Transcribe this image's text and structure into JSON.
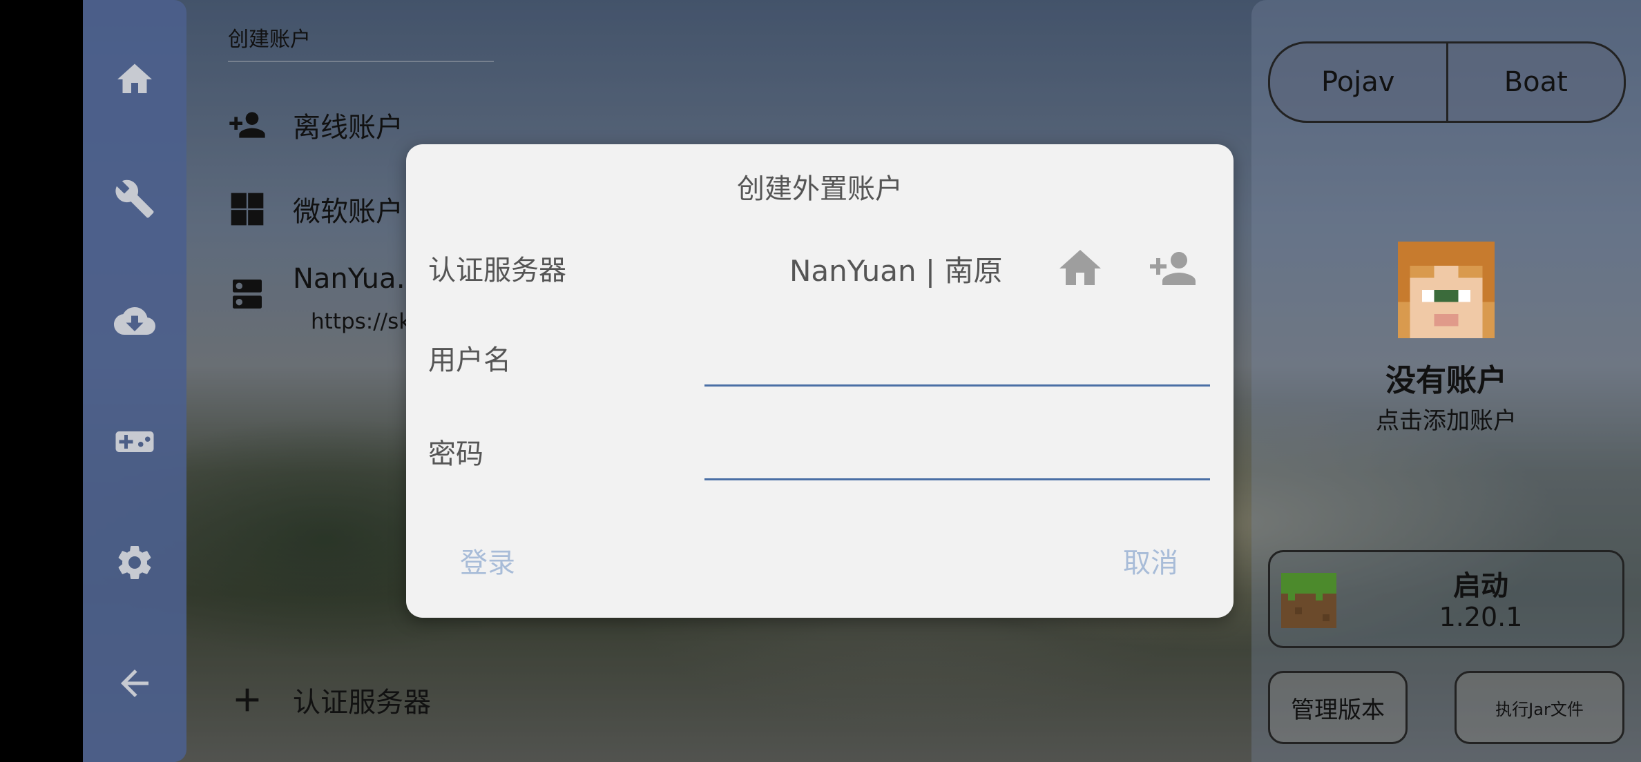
{
  "left_rail": {
    "items": [
      {
        "name": "home-icon"
      },
      {
        "name": "wrench-icon"
      },
      {
        "name": "cloud-download-icon"
      },
      {
        "name": "gamepad-icon"
      },
      {
        "name": "gear-icon"
      },
      {
        "name": "back-arrow-icon"
      }
    ]
  },
  "accounts": {
    "title": "创建账户",
    "offline_label": "离线账户",
    "microsoft_label": "微软账户",
    "server_item": {
      "name": "NanYua…",
      "url": "https://skin"
    },
    "add_server_label": "认证服务器"
  },
  "dialog": {
    "title": "创建外置账户",
    "server_label": "认证服务器",
    "server_value": "NanYuan | 南原",
    "username_label": "用户名",
    "username_value": "",
    "password_label": "密码",
    "password_value": "",
    "login_label": "登录",
    "cancel_label": "取消"
  },
  "right_panel": {
    "launcher_tabs": [
      "Pojav",
      "Boat"
    ],
    "no_account": "没有账户",
    "tap_add": "点击添加账户",
    "launch_label": "启动",
    "launch_version": "1.20.1",
    "manage_versions": "管理版本",
    "run_jar": "执行Jar文件"
  },
  "colors": {
    "rail": "#4c608c",
    "dialog_bg": "#f2f2f2",
    "field_underline": "#4a6fa5",
    "dialog_button": "#a8bcd8"
  }
}
